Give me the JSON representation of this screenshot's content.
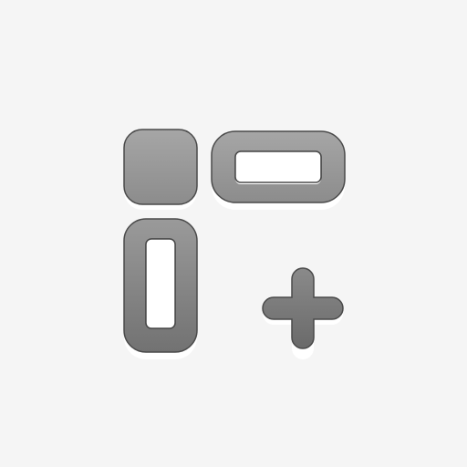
{
  "icon": {
    "name": "add-widget-icon",
    "description_visible": false,
    "colors": {
      "background": "#f5f5f5",
      "fill_top": "#a6a6a6",
      "fill_bottom": "#8a8a8a",
      "stroke": "#4a4a4a",
      "highlight": "#ffffff"
    },
    "parts": [
      "widget-square",
      "widget-horizontal-pill",
      "widget-vertical-pill",
      "plus-sign"
    ]
  }
}
